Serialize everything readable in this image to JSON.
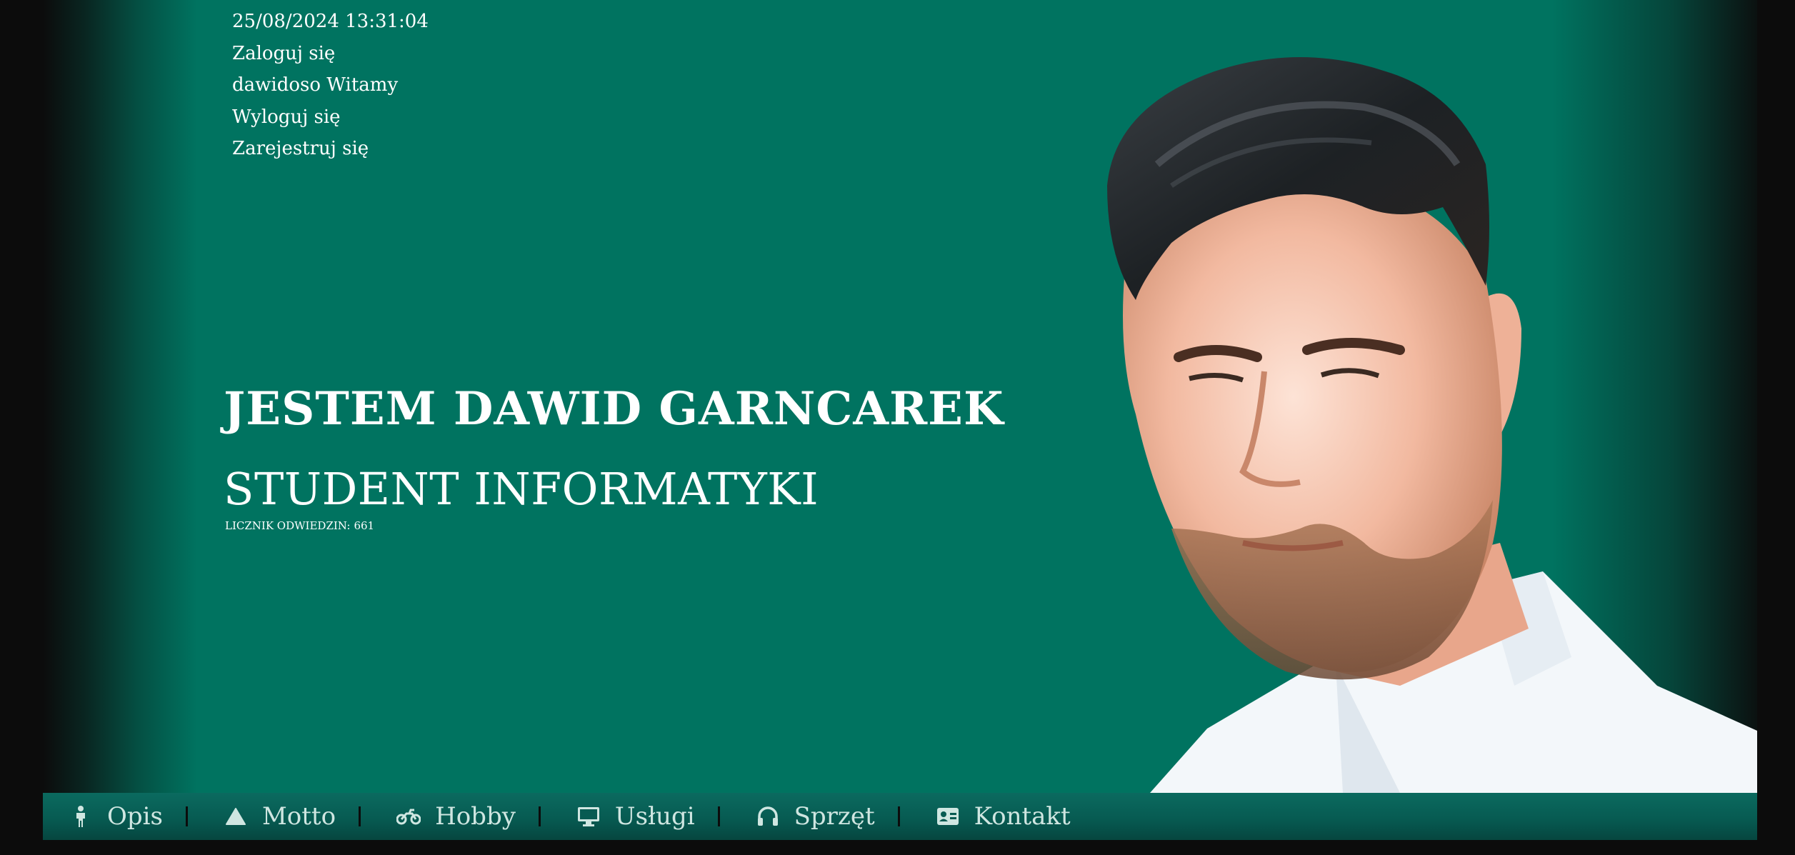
{
  "header": {
    "datetime": "25/08/2024 13:31:04",
    "login_label": "Zaloguj się",
    "welcome_text": "dawidoso Witamy",
    "logout_label": "Wyloguj się",
    "register_label": "Zarejestruj się"
  },
  "hero": {
    "headline": "JESTEM DAWID GARNCAREK",
    "subheadline": "STUDENT INFORMATYKI",
    "counter_label": "LICZNIK ODWIEDZIN:",
    "counter_value": "661"
  },
  "nav": {
    "items": [
      {
        "label": "Opis",
        "icon": "person-icon"
      },
      {
        "label": "Motto",
        "icon": "triangle-icon"
      },
      {
        "label": "Hobby",
        "icon": "motorcycle-icon"
      },
      {
        "label": "Usługi",
        "icon": "monitor-icon"
      },
      {
        "label": "Sprzęt",
        "icon": "headphones-icon"
      },
      {
        "label": "Kontakt",
        "icon": "contact-card-icon"
      }
    ]
  },
  "colors": {
    "background": "#007360",
    "page_edge": "#0c0c0c",
    "nav_bar": "#075b52",
    "text": "#ffffff"
  }
}
